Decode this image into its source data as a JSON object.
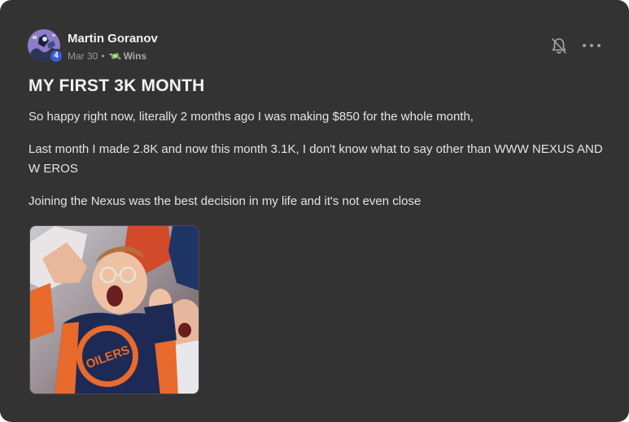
{
  "post": {
    "author": {
      "name": "Martin Goranov",
      "level": "4"
    },
    "date": "Mar 30",
    "separator": "•",
    "category": {
      "icon": "money-with-wings-icon",
      "label": "Wins"
    },
    "title": "MY FIRST 3K MONTH",
    "paragraphs": [
      "So happy right now, literally 2 months ago I was making $850 for the whole month,",
      "Last month I made 2.8K and now this month 3.1K, I don't know what to say other than WWW NEXUS AND W EROS",
      "Joining the Nexus was the best decision in my life and it's not even close"
    ],
    "actions": {
      "notify_icon": "bell-off-icon",
      "more_icon": "more-horizontal-icon"
    },
    "media": {
      "image_type": "celebration-gif",
      "jersey_text": "OILERS"
    }
  },
  "colors": {
    "card_bg": "#333333",
    "text": "#e4e4e4",
    "muted": "#9a9a9a",
    "badge": "#3b5bdb"
  }
}
